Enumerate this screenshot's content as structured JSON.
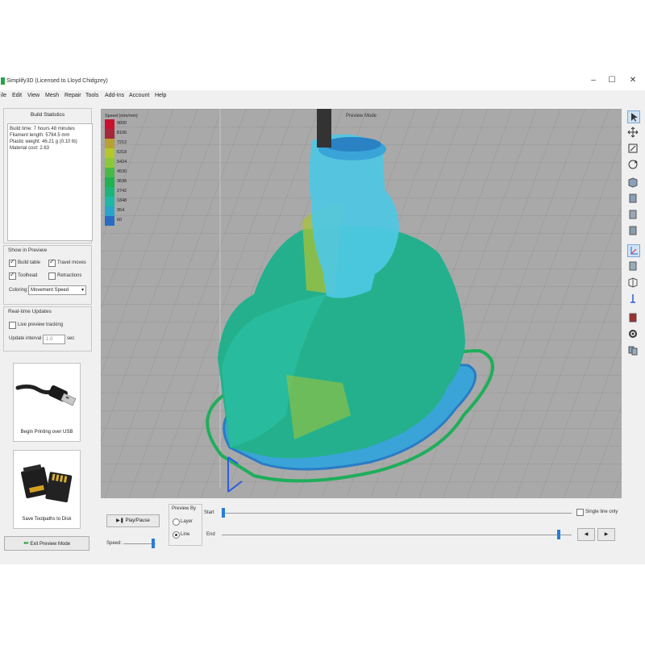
{
  "window": {
    "title": "Simplify3D (Licensed to Lloyd Chidgzey)",
    "controls": [
      "–",
      "☐",
      "✕"
    ]
  },
  "menu": [
    "ile",
    "Edit",
    "View",
    "Mesh",
    "Repair",
    "Tools",
    "Add-Ins",
    "Account",
    "Help"
  ],
  "build_statistics": {
    "title": "Build Statistics",
    "lines": [
      "Build time: 7 hours 48 minutes",
      "Filament length: 5794.5 mm",
      "Plastic weight: 46.21 g (0.10 lb)",
      "Material cost: 2.63"
    ]
  },
  "show_in_preview": {
    "title": "Show in Preview",
    "build_table": "Build table",
    "travel_moves": "Travel moves",
    "toolhead": "Toolhead",
    "retractions": "Retractions",
    "coloring_label": "Coloring:",
    "coloring_value": "Movement Speed"
  },
  "realtime": {
    "title": "Real-time Updates",
    "live_preview": "Live preview tracking",
    "update_interval_label": "Update interval",
    "update_interval_value": "1.0",
    "update_interval_unit": "sec"
  },
  "usb_card": {
    "label": "Begin Printing over USB"
  },
  "sd_card": {
    "label": "Save Toolpaths to Disk"
  },
  "exit_button": "Exit Preview Mode",
  "viewport": {
    "mode_label": "Preview Mode"
  },
  "legend": {
    "title": "Speed (mm/min)",
    "entries": [
      {
        "value": "9000",
        "color": "#c8102e"
      },
      {
        "value": "8106",
        "color": "#a4283c"
      },
      {
        "value": "7212",
        "color": "#b8a032"
      },
      {
        "value": "6318",
        "color": "#b4c82c"
      },
      {
        "value": "5424",
        "color": "#8cc83a"
      },
      {
        "value": "4530",
        "color": "#4ab848"
      },
      {
        "value": "3636",
        "color": "#22b050"
      },
      {
        "value": "2742",
        "color": "#1cb47a"
      },
      {
        "value": "1848",
        "color": "#20b8a4"
      },
      {
        "value": "954",
        "color": "#2aa4c8"
      },
      {
        "value": "60",
        "color": "#2a6cc4"
      }
    ]
  },
  "controls": {
    "play_pause": "Play/Pause",
    "speed_label": "Speed:",
    "preview_by": "Preview By",
    "layer": "Layer",
    "line": "Line",
    "start_label": "Start",
    "end_label": "End",
    "single_line": "Single line only",
    "prev_icon": "◀",
    "next_icon": "▶"
  }
}
